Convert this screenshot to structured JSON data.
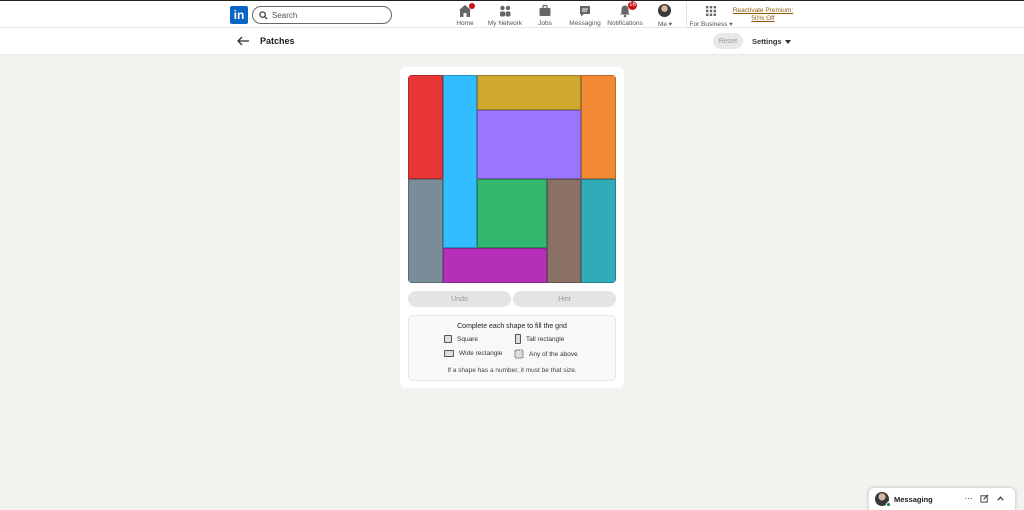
{
  "nav": {
    "logo_text": "in",
    "search_placeholder": "Search",
    "items": [
      {
        "label": "Home",
        "badge": ""
      },
      {
        "label": "My Network",
        "badge": ""
      },
      {
        "label": "Jobs",
        "badge": ""
      },
      {
        "label": "Messaging",
        "badge": ""
      },
      {
        "label": "Notifications",
        "badge": "16"
      },
      {
        "label": "Me",
        "badge": ""
      },
      {
        "label": "For Business",
        "badge": ""
      }
    ],
    "premium_line1": "Reactivate Premium:",
    "premium_line2": "50% Off"
  },
  "header": {
    "title": "Patches",
    "reset_label": "Reset",
    "settings_label": "Settings"
  },
  "board": {
    "grid_size": 6,
    "pieces": [
      {
        "name": "red",
        "color": "#e83535",
        "col": 0,
        "row": 0,
        "w": 1,
        "h": 3
      },
      {
        "name": "cyan",
        "color": "#33bcff",
        "col": 1,
        "row": 0,
        "w": 1,
        "h": 5
      },
      {
        "name": "gold",
        "color": "#d0a72f",
        "col": 2,
        "row": 0,
        "w": 3,
        "h": 1
      },
      {
        "name": "orange",
        "color": "#f28a35",
        "col": 5,
        "row": 0,
        "w": 1,
        "h": 3
      },
      {
        "name": "purple",
        "color": "#9b74ff",
        "col": 2,
        "row": 1,
        "w": 3,
        "h": 2
      },
      {
        "name": "slate",
        "color": "#7a8c97",
        "col": 0,
        "row": 3,
        "w": 1,
        "h": 3
      },
      {
        "name": "green",
        "color": "#31b76e",
        "col": 2,
        "row": 3,
        "w": 2,
        "h": 2
      },
      {
        "name": "brown",
        "color": "#8b7066",
        "col": 4,
        "row": 3,
        "w": 1,
        "h": 3
      },
      {
        "name": "teal",
        "color": "#31abb7",
        "col": 5,
        "row": 3,
        "w": 1,
        "h": 3
      },
      {
        "name": "magenta",
        "color": "#b62fb9",
        "col": 1,
        "row": 5,
        "w": 3,
        "h": 1
      }
    ]
  },
  "actions": {
    "undo_label": "Undo",
    "hint_label": "Hint"
  },
  "rules": {
    "title": "Complete each shape to fill the grid",
    "square": "Square",
    "tall": "Tall rectangle",
    "wide": "Wide rectangle",
    "any": "Any of the above",
    "footer": "If a shape has a number, it must be that size."
  },
  "messaging": {
    "label": "Messaging"
  }
}
